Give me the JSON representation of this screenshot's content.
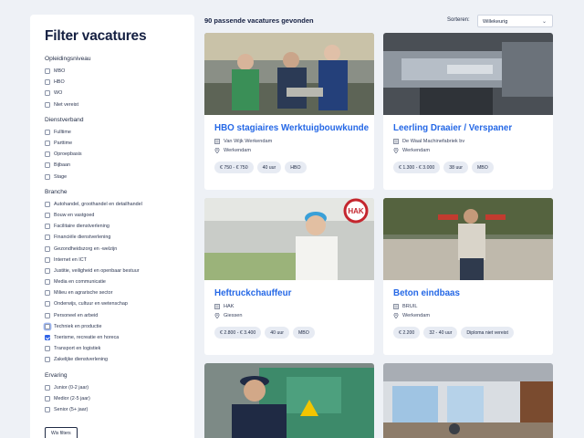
{
  "sidebar": {
    "title": "Filter vacatures",
    "groups": [
      {
        "title": "Opleidingsniveau",
        "options": [
          {
            "label": "MBO",
            "checked": false
          },
          {
            "label": "HBO",
            "checked": false
          },
          {
            "label": "WO",
            "checked": false
          },
          {
            "label": "Niet vereist",
            "checked": false
          }
        ]
      },
      {
        "title": "Dienstverband",
        "options": [
          {
            "label": "Fulltime",
            "checked": false
          },
          {
            "label": "Parttime",
            "checked": false
          },
          {
            "label": "Oproepbasis",
            "checked": false
          },
          {
            "label": "Bijbaan",
            "checked": false
          },
          {
            "label": "Stage",
            "checked": false
          }
        ]
      },
      {
        "title": "Branche",
        "options": [
          {
            "label": "Autohandel, groothandel en detailhandel",
            "checked": false
          },
          {
            "label": "Bouw en vastgoed",
            "checked": false
          },
          {
            "label": "Facilitaire dienstverlening",
            "checked": false
          },
          {
            "label": "Financiële dienstverlening",
            "checked": false
          },
          {
            "label": "Gezondheidszorg en -welzijn",
            "checked": false
          },
          {
            "label": "Internet en ICT",
            "checked": false
          },
          {
            "label": "Justitie, veiligheid en openbaar bestuur",
            "checked": false
          },
          {
            "label": "Media en communicatie",
            "checked": false
          },
          {
            "label": "Milieu en agrarische sector",
            "checked": false
          },
          {
            "label": "Onderwijs, cultuur en wetenschap",
            "checked": false
          },
          {
            "label": "Personeel en arbeid",
            "checked": false
          },
          {
            "label": "Techniek en productie",
            "checked": false,
            "focused": true
          },
          {
            "label": "Toerisme, recreatie en horeca",
            "checked": true
          },
          {
            "label": "Transport en logistiek",
            "checked": false
          },
          {
            "label": "Zakelijke dienstverlening",
            "checked": false
          }
        ]
      },
      {
        "title": "Ervaring",
        "options": [
          {
            "label": "Junior (0-2 jaar)",
            "checked": false
          },
          {
            "label": "Medior (2-5 jaar)",
            "checked": false
          },
          {
            "label": "Senior (5+ jaar)",
            "checked": false
          }
        ]
      }
    ],
    "clear_label": "Wis filters"
  },
  "main": {
    "result_count": "90 passende vacatures gevonden",
    "sort_label": "Sorteren:",
    "sort_value": "Willekeurig",
    "cards": [
      {
        "title": "HBO stagiaires Werktuigbouwkunde",
        "company": "Van Wijk Werkendam",
        "location": "Werkendam",
        "tags": [
          "€ 750 - € 750",
          "40 uur",
          "HBO"
        ],
        "image": "workshop-photo"
      },
      {
        "title": "Leerling Draaier / Verspaner",
        "company": "De Waal Machinefabriek bv",
        "location": "Werkendam",
        "tags": [
          "€ 1.300 - € 3.000",
          "38 uur",
          "MBO"
        ],
        "image": "lathe-photo"
      },
      {
        "title": "Heftruckchauffeur",
        "company": "HAK",
        "location": "Giessen",
        "tags": [
          "€ 2.800 - € 3.400",
          "40 uur",
          "MBO"
        ],
        "image": "factory-worker-photo"
      },
      {
        "title": "Beton eindbaas",
        "company": "BRUIL",
        "location": "Werkendam",
        "tags": [
          "€ 2.200",
          "32 - 40 uur",
          "Diploma niet vereist"
        ],
        "image": "concrete-worker-photo"
      },
      {
        "title": "",
        "company": "",
        "location": "",
        "tags": [],
        "image": "electrician-photo"
      },
      {
        "title": "",
        "company": "",
        "location": "",
        "tags": [],
        "image": "office-photo"
      }
    ]
  },
  "colors": {
    "accent": "#2568e6",
    "background": "#eef1f6",
    "checkbox_checked": "#2f62e6"
  }
}
